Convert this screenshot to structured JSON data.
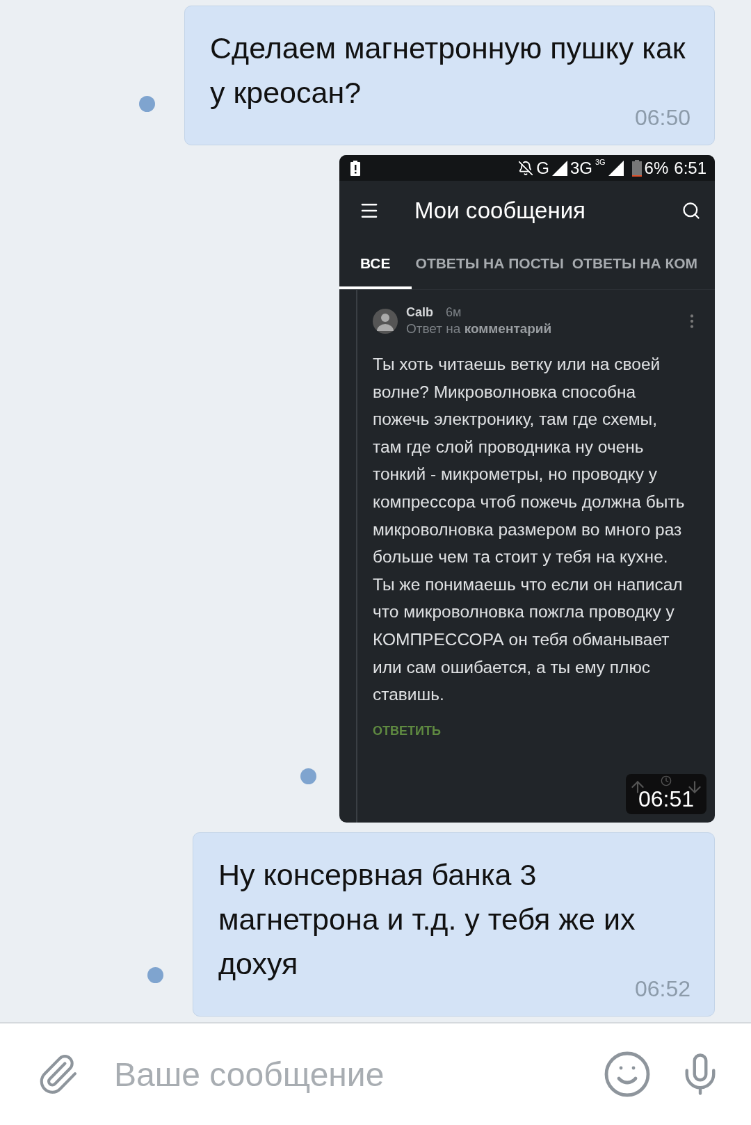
{
  "messages": [
    {
      "kind": "text",
      "text": "Сделаем магнетронную пушку как у креосан?",
      "time": "06:50"
    },
    {
      "kind": "screenshot",
      "time": "06:51",
      "screen": {
        "status_bar": {
          "network_1": "G",
          "network_2": "3G",
          "network_2_badge": "3G",
          "battery": "6%",
          "time": "6:51"
        },
        "title": "Мои сообщения",
        "tabs": [
          {
            "label": "ВСЕ",
            "selected": true
          },
          {
            "label": "ОТВЕТЫ НА ПОСТЫ",
            "selected": false
          },
          {
            "label": "ОТВЕТЫ НА КОМ",
            "selected": false
          }
        ],
        "comment": {
          "author": "Calb",
          "age": "6м",
          "reply_to": "Ответ на **комментарий**",
          "body": "Ты хоть читаешь ветку или на своей волне? Микроволновка способна пожечь электронику, там где схемы, там где слой проводника ну очень тонкий - микрометры, но проводку у компрессора чтоб пожечь должна быть микроволновка размером во много раз больше чем та стоит у тебя на кухне. Ты же понимаешь что если он написал что микроволновка пожгла проводку у КОМПРЕССОРА он тебя обманывает или сам ошибается, а ты ему плюс ставишь.",
          "reply_button": "ОТВЕТИТЬ"
        }
      }
    },
    {
      "kind": "text",
      "text": "Ну консервная банка 3 магнетрона и т.д. у тебя же их дохуя",
      "time": "06:52"
    }
  ],
  "composer": {
    "placeholder": "Ваше сообщение"
  }
}
